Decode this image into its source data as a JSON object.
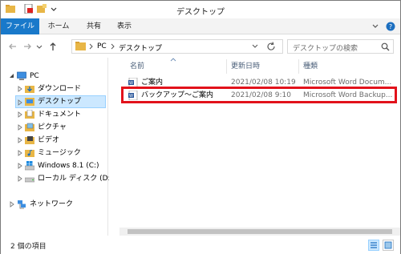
{
  "window": {
    "title": "デスクトップ"
  },
  "ribbon": {
    "tabs": [
      {
        "label": "ファイル"
      },
      {
        "label": "ホーム"
      },
      {
        "label": "共有"
      },
      {
        "label": "表示"
      }
    ]
  },
  "navigation": {
    "breadcrumb": [
      "PC",
      "デスクトップ"
    ],
    "search_placeholder": "デスクトップの検索"
  },
  "tree": {
    "items": [
      {
        "label": "PC"
      },
      {
        "label": "ダウンロード"
      },
      {
        "label": "デスクトップ"
      },
      {
        "label": "ドキュメント"
      },
      {
        "label": "ピクチャ"
      },
      {
        "label": "ビデオ"
      },
      {
        "label": "ミュージック"
      },
      {
        "label": "Windows 8.1 (C:)"
      },
      {
        "label": "ローカル ディスク (D:)"
      },
      {
        "label": "ネットワーク"
      }
    ]
  },
  "columns": {
    "name": "名前",
    "date": "更新日時",
    "type": "種類"
  },
  "files": [
    {
      "name": "ご案内",
      "date": "2021/02/08 10:19",
      "type": "Microsoft Word Docum..."
    },
    {
      "name": "バックアップ～ご案内",
      "date": "2021/02/08 9:10",
      "type": "Microsoft Word Backup..."
    }
  ],
  "status": {
    "item_count": "2 個の項目"
  },
  "colors": {
    "accent": "#1979ca",
    "highlight_border": "#e2121b",
    "selection": "#cce8ff"
  }
}
